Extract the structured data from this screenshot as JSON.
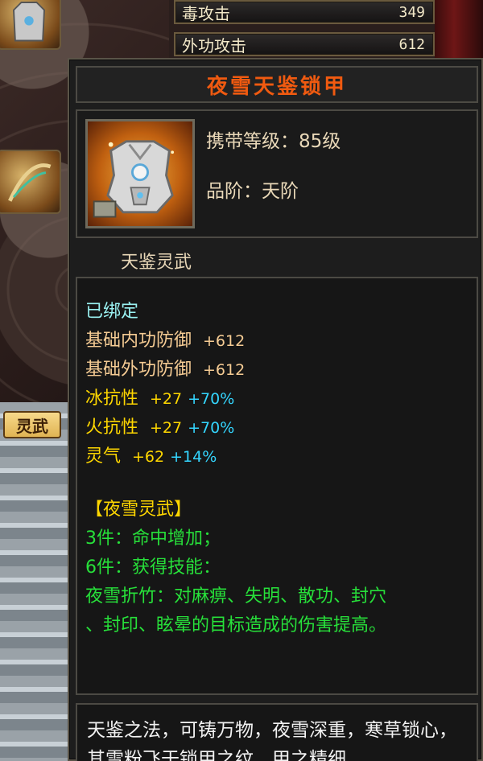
{
  "background": {
    "stats": [
      {
        "label": "毒攻击",
        "value": "349"
      },
      {
        "label": "外功攻击",
        "value": "612"
      }
    ],
    "tab_label": "灵武"
  },
  "tooltip": {
    "title": "夜雪天鉴锁甲",
    "carry_level": "携带等级：85级",
    "grade": "品阶：天阶",
    "subtitle": "天鉴灵武",
    "bound": "已绑定",
    "base_stats": [
      {
        "label": "基础内功防御",
        "value": "+612"
      },
      {
        "label": "基础外功防御",
        "value": "+612"
      }
    ],
    "resist_stats": [
      {
        "label": "冰抗性",
        "value": "+27",
        "bonus": "+70%"
      },
      {
        "label": "火抗性",
        "value": "+27",
        "bonus": "+70%"
      },
      {
        "label": "灵气",
        "value": "+62",
        "bonus": "+14%"
      }
    ],
    "set_name": "【夜雪灵武】",
    "set_bonuses": [
      "3件：命中增加；",
      "6件：获得技能：",
      "夜雪折竹：对麻痹、失明、散功、封穴",
      "、封印、眩晕的目标造成的伤害提高。"
    ],
    "description": "天鉴之法，可铸万物，夜雪深重，寒草锁心，其雪粉飞于锁甲之纹，甲之精细"
  },
  "colors": {
    "title": "#f05a10",
    "cyan": "#9af2f2",
    "tan": "#f6cc94",
    "yellow": "#ffd700",
    "blue": "#34d6ff",
    "green": "#27e03a"
  }
}
